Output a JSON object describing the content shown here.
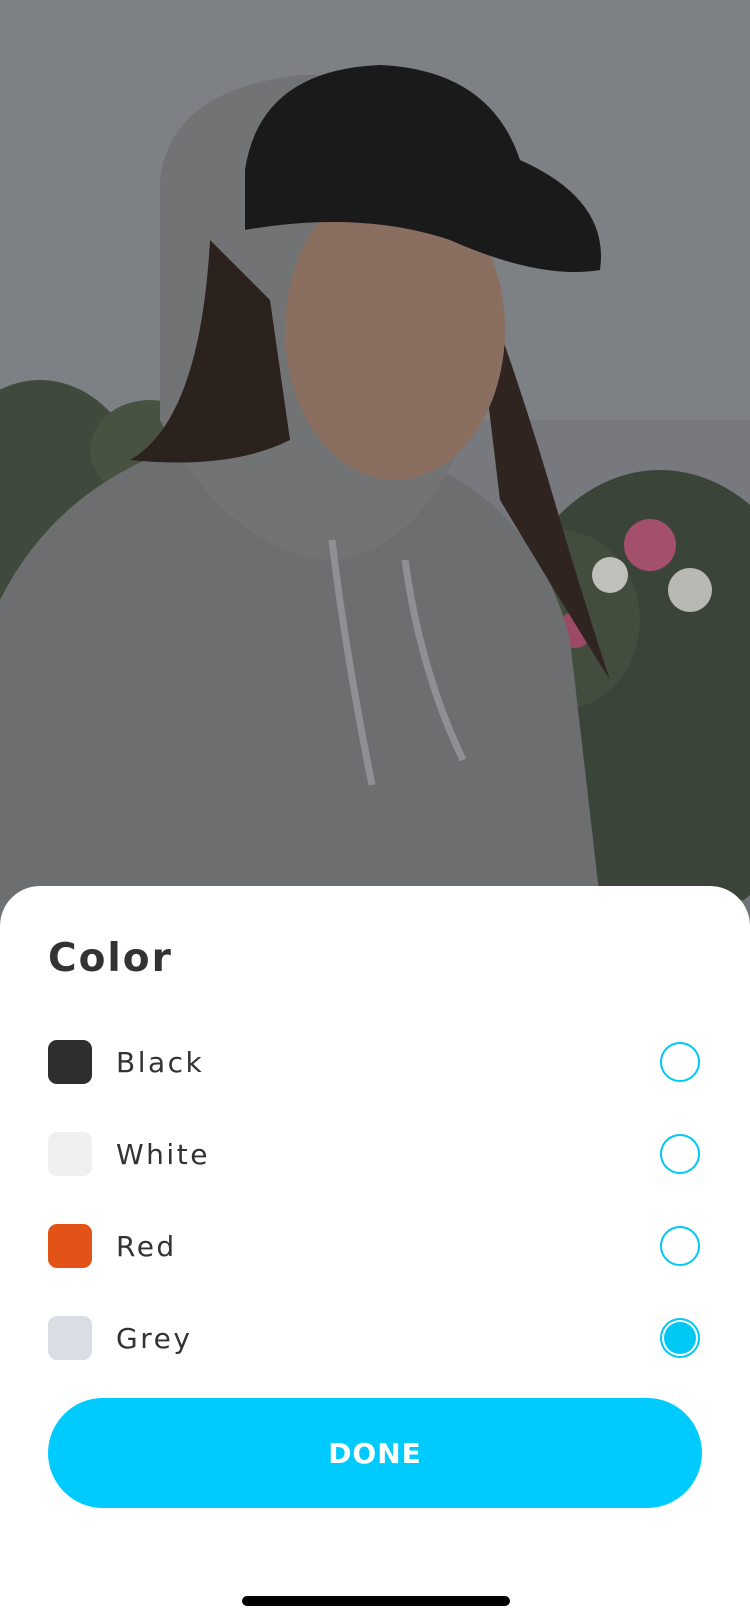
{
  "sheet": {
    "title": "Color",
    "options": [
      {
        "label": "Black",
        "swatch_color": "#2e2e2e",
        "selected": false
      },
      {
        "label": "White",
        "swatch_color": "#f0f0f0",
        "selected": false
      },
      {
        "label": "Red",
        "swatch_color": "#e35317",
        "selected": false
      },
      {
        "label": "Grey",
        "swatch_color": "#d9dee4",
        "selected": true
      }
    ],
    "done_label": "DONE"
  },
  "colors": {
    "accent": "#00cbff",
    "radio": "#00c8f5",
    "text": "#333333",
    "sheet_background": "#ffffff"
  },
  "photo": {
    "icon": "product-photo-hoodie-model"
  }
}
